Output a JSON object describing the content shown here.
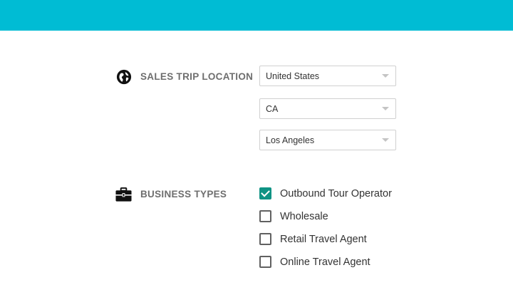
{
  "colors": {
    "header": "#00bcd4",
    "checkbox_checked": "#0f9384"
  },
  "location": {
    "label": "SALES TRIP LOCATION",
    "icon": "globe-icon",
    "country": "United States",
    "state": "CA",
    "city": "Los Angeles"
  },
  "business": {
    "label": "BUSINESS TYPES",
    "icon": "briefcase-icon",
    "options": [
      {
        "label": "Outbound Tour Operator",
        "checked": true
      },
      {
        "label": "Wholesale",
        "checked": false
      },
      {
        "label": "Retail Travel Agent",
        "checked": false
      },
      {
        "label": "Online Travel Agent",
        "checked": false
      }
    ]
  }
}
